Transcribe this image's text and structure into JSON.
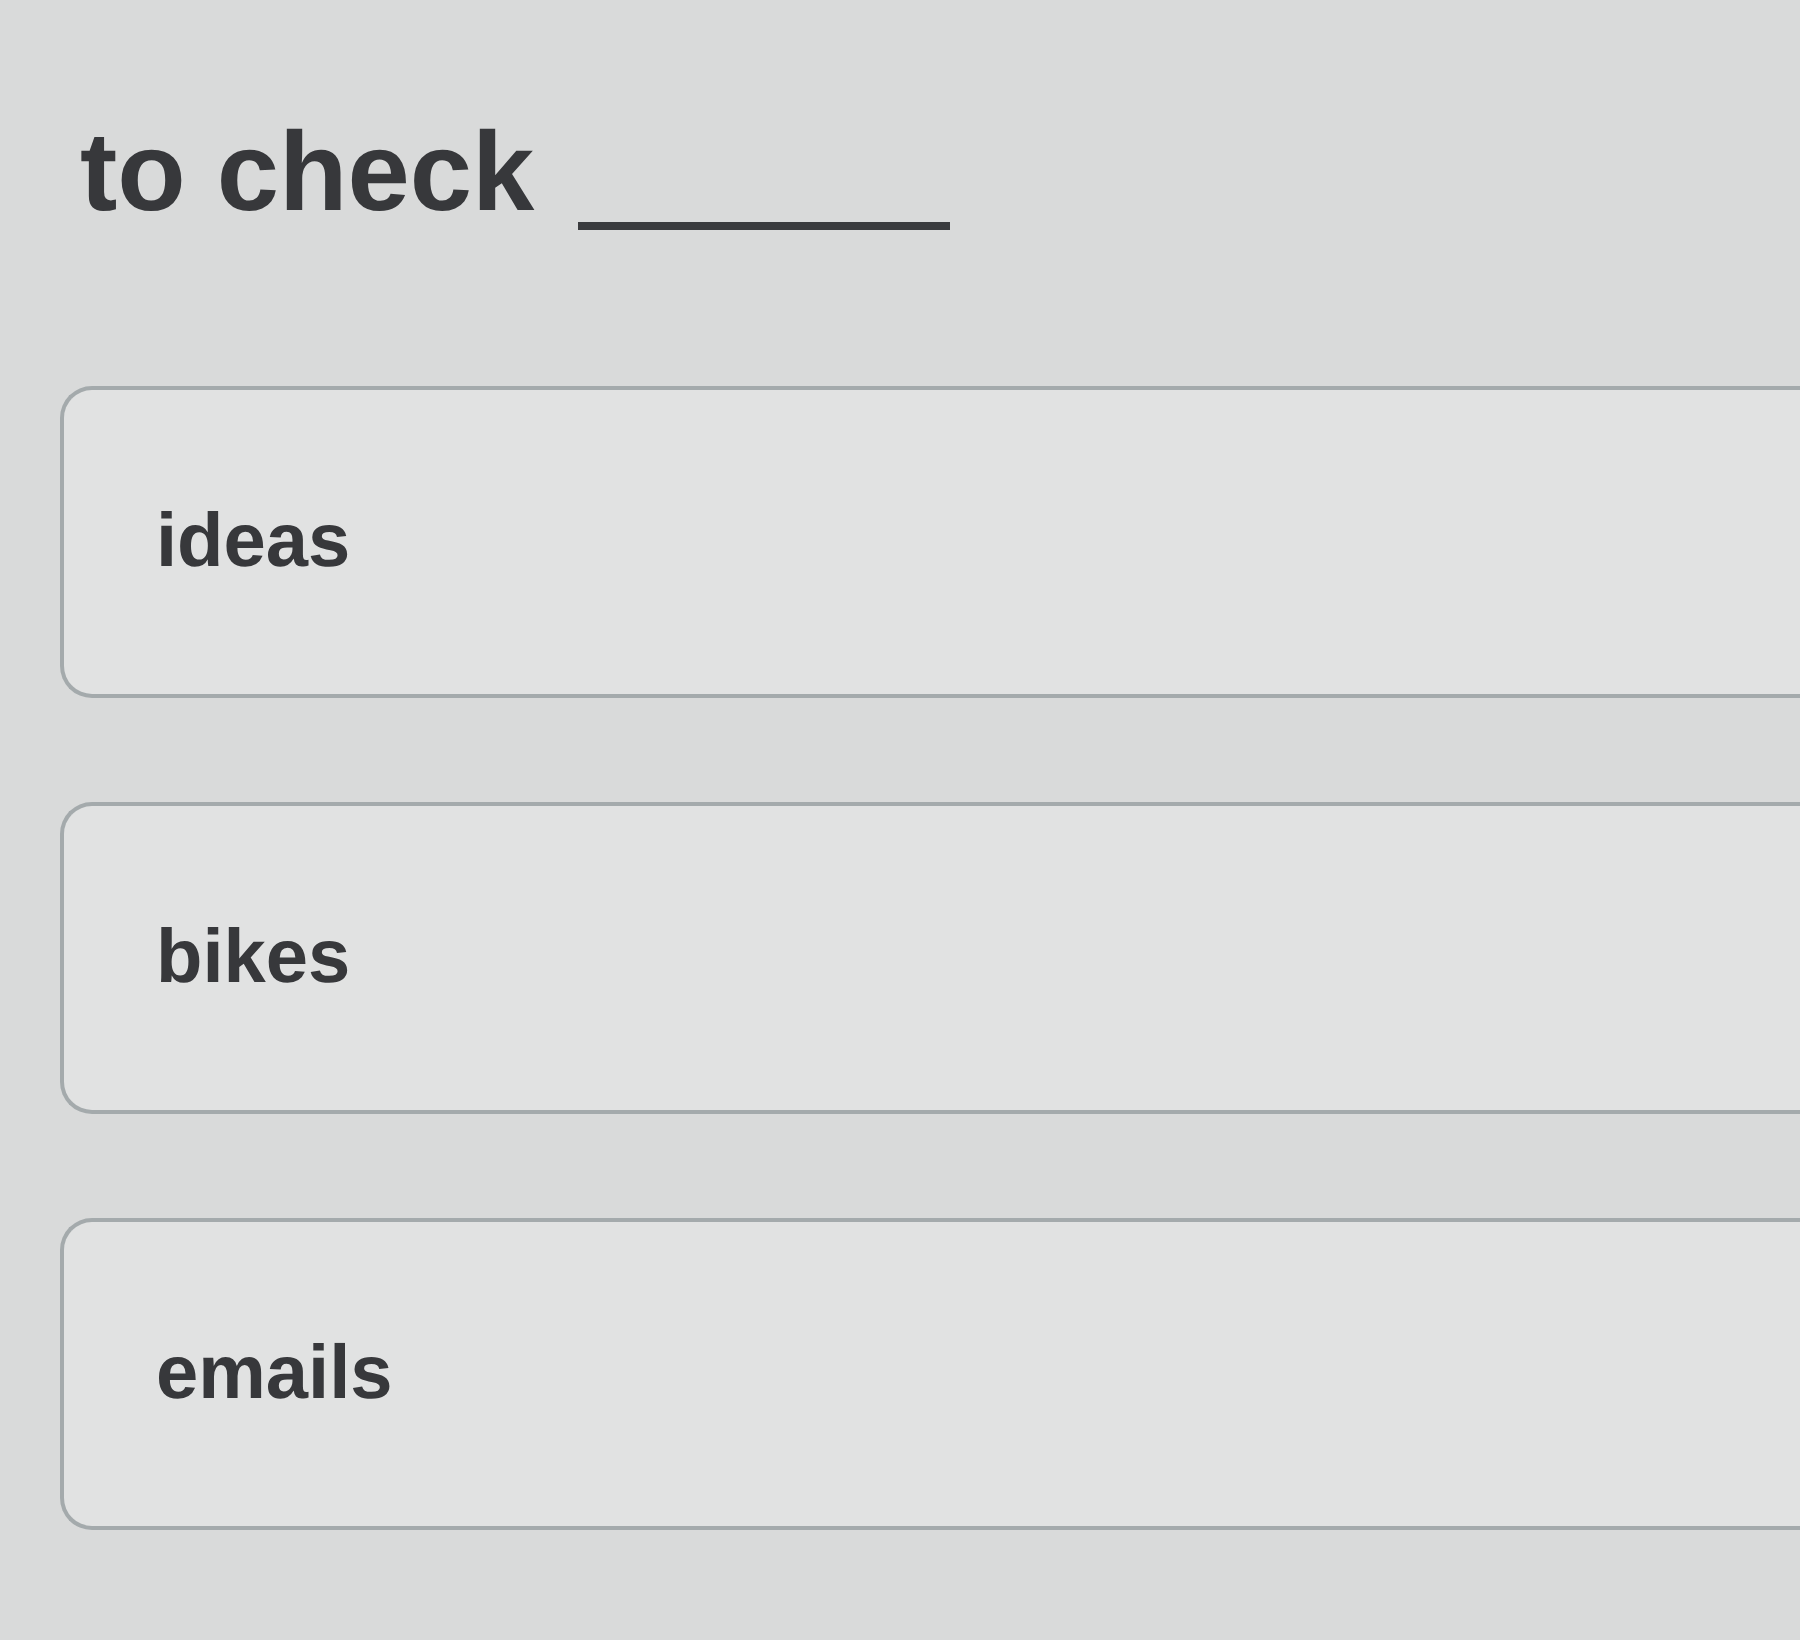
{
  "question": {
    "prompt": "to check"
  },
  "options": [
    {
      "label": "ideas",
      "selected": false
    },
    {
      "label": "bikes",
      "selected": false
    },
    {
      "label": "emails",
      "selected": false
    }
  ]
}
